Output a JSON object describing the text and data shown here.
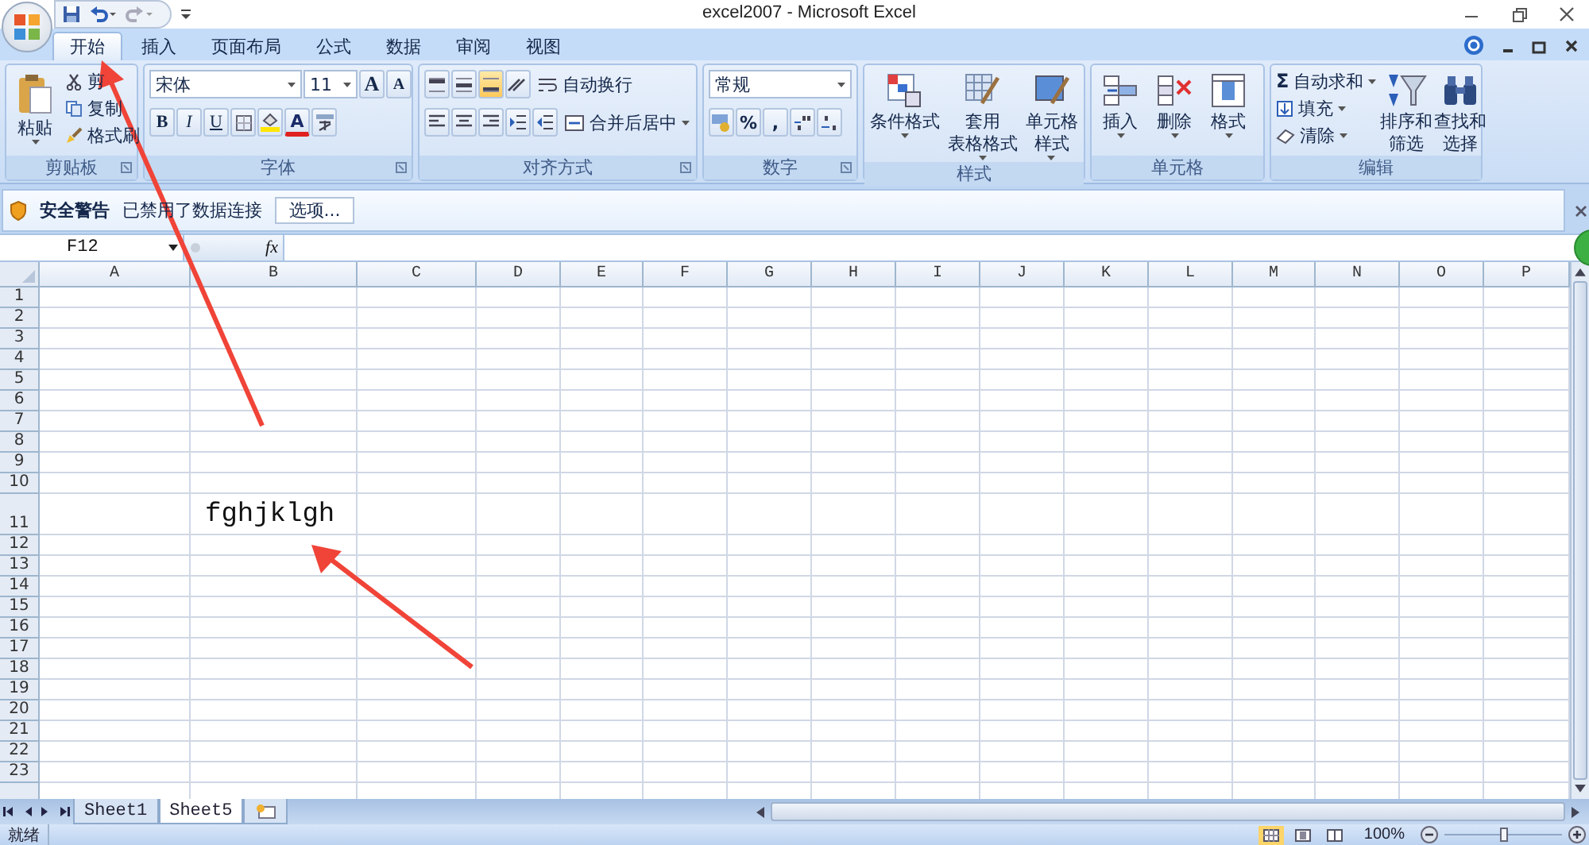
{
  "window": {
    "title": "excel2007 - Microsoft Excel"
  },
  "tabs": [
    {
      "label": "开始",
      "selected": true
    },
    {
      "label": "插入",
      "selected": false
    },
    {
      "label": "页面布局",
      "selected": false
    },
    {
      "label": "公式",
      "selected": false
    },
    {
      "label": "数据",
      "selected": false
    },
    {
      "label": "审阅",
      "selected": false
    },
    {
      "label": "视图",
      "selected": false
    }
  ],
  "quick_access": {
    "redo_disabled": true
  },
  "ribbon_groups": [
    {
      "kind": "clipboard",
      "label": "剪贴板",
      "paste": "粘贴",
      "small": [
        "剪",
        "复制",
        "格式刷"
      ]
    },
    {
      "kind": "font",
      "label": "字体",
      "font": "宋体",
      "size": "11",
      "grow": "A",
      "shrink": "A",
      "styles": [
        "B",
        "I",
        "U"
      ],
      "font_color": "A"
    },
    {
      "kind": "alignment",
      "label": "对齐方式",
      "wrap": "自动换行",
      "merge": "合并后居中"
    },
    {
      "kind": "number",
      "label": "数字",
      "format": "常规",
      "percent": "%",
      "comma": ","
    },
    {
      "kind": "styles",
      "label": "样式",
      "buttons": [
        {
          "lines": [
            "条件格式"
          ]
        },
        {
          "lines": [
            "套用",
            "表格格式"
          ]
        },
        {
          "lines": [
            "单元格",
            "样式"
          ]
        }
      ]
    },
    {
      "kind": "cells",
      "label": "单元格",
      "buttons": [
        {
          "lines": [
            "插入"
          ]
        },
        {
          "lines": [
            "删除"
          ]
        },
        {
          "lines": [
            "格式"
          ]
        }
      ]
    },
    {
      "kind": "editing",
      "label": "编辑",
      "sum_symbol": "Σ",
      "small": [
        "自动求和",
        "填充",
        "清除"
      ],
      "buttons": [
        {
          "lines": [
            "排序和",
            "筛选"
          ]
        },
        {
          "lines": [
            "查找和",
            "选择"
          ]
        }
      ]
    }
  ],
  "security_bar": {
    "title": "安全警告",
    "message": "已禁用了数据连接",
    "button": "选项..."
  },
  "formula_bar": {
    "name_box": "F12",
    "function_label": "fx"
  },
  "columns": [
    "A",
    "B",
    "C",
    "D",
    "E",
    "F",
    "G",
    "H",
    "I",
    "J",
    "K",
    "L",
    "M",
    "N",
    "O",
    "P"
  ],
  "rows": [
    {
      "header": "1"
    },
    {
      "header": "2"
    },
    {
      "header": "3"
    },
    {
      "header": "4"
    },
    {
      "header": "5"
    },
    {
      "header": "6"
    },
    {
      "header": "7"
    },
    {
      "header": "8"
    },
    {
      "header": "9"
    },
    {
      "header": "10"
    },
    {
      "header": "11",
      "cells": [
        null,
        "fghjklgh"
      ]
    },
    {
      "header": "12"
    },
    {
      "header": "13"
    },
    {
      "header": "14"
    },
    {
      "header": "15"
    },
    {
      "header": "16"
    },
    {
      "header": "17"
    },
    {
      "header": "18"
    },
    {
      "header": "19"
    },
    {
      "header": "20"
    },
    {
      "header": "21"
    },
    {
      "header": "22"
    },
    {
      "header": "23"
    }
  ],
  "sheets": [
    {
      "label": "Sheet1",
      "selected": false
    },
    {
      "label": "Sheet5",
      "selected": true
    }
  ],
  "status_bar": {
    "text": "就绪",
    "views": [
      {
        "selected": true
      },
      {
        "selected": false
      },
      {
        "selected": false
      }
    ],
    "zoom": "100%",
    "zoom_slider": {
      "level": 0.5
    }
  }
}
